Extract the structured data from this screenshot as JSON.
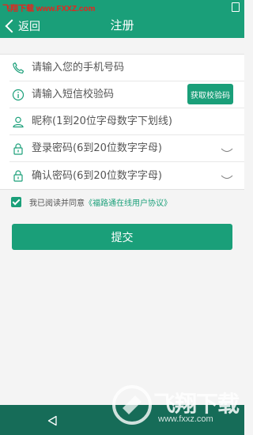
{
  "watermark": {
    "top": "飞翔下载 www.FXXZ.com",
    "brand": "飞翔下载",
    "url": "www.fxxz.com"
  },
  "header": {
    "back_label": "返回",
    "title": "注册"
  },
  "form": {
    "phone_placeholder": "请输入您的手机号码",
    "code_placeholder": "请输入短信校验码",
    "get_code_label": "获取校验码",
    "nickname_placeholder": "昵称(1到20位字母数字下划线)",
    "password_placeholder": "登录密码(6到20位数字字母)",
    "confirm_placeholder": "确认密码(6到20位数字字母)"
  },
  "agreement": {
    "checked": true,
    "text": "我已阅读并同意",
    "link": "《福路通在线用户协议》"
  },
  "submit_label": "提交",
  "colors": {
    "accent": "#1a9f79",
    "nav": "#166c58",
    "background": "#f4f4f4"
  }
}
